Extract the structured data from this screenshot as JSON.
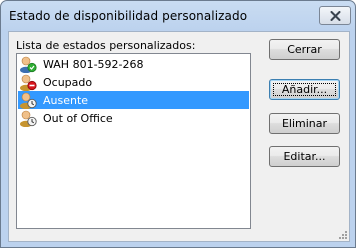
{
  "window": {
    "title": "Estado de disponibilidad personalizado"
  },
  "list": {
    "label": "Lista de estados personalizados:",
    "items": [
      {
        "label": "WAH 801-592-268",
        "icon": "available-status-icon",
        "selected": false
      },
      {
        "label": "Ocupado",
        "icon": "busy-status-icon",
        "selected": false
      },
      {
        "label": "Ausente",
        "icon": "away-status-icon",
        "selected": true
      },
      {
        "label": "Out of Office",
        "icon": "away-status-icon",
        "selected": false
      }
    ]
  },
  "buttons": {
    "close": "Cerrar",
    "add": "Añadir...",
    "delete": "Eliminar",
    "edit": "Editar..."
  },
  "colors": {
    "selection": "#3399ff",
    "available": "#2eae34",
    "busy": "#d8141c",
    "away": "#7a7a7a"
  }
}
